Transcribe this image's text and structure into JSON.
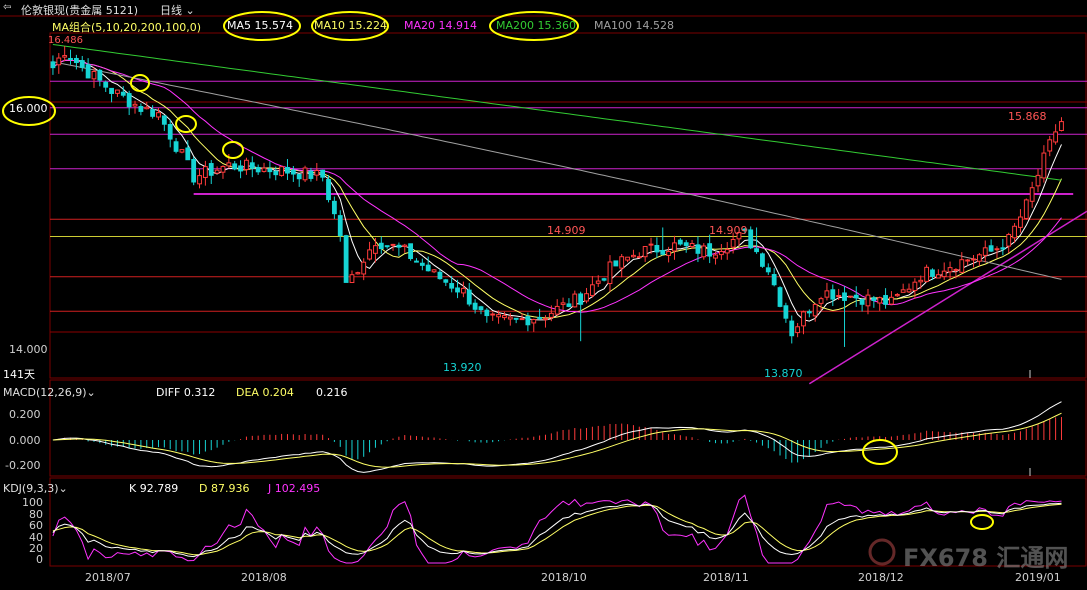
{
  "header": {
    "nav_icon": "back-arrow-icon",
    "instrument": "伦敦银现(贵金属 5121)",
    "period": "日线",
    "period_icon": "chevron-down-icon"
  },
  "colors": {
    "background": "#000000",
    "up": "#ff3b3b",
    "down": "#16d4d4",
    "ma5": "#ffffff",
    "ma10": "#ffff66",
    "ma20": "#ff33ff",
    "ma200": "#33cc33",
    "ma100": "#a0a0a0",
    "annotation_line": "#cc22cc",
    "annotation_circle": "#ffff00",
    "grid": "#8b0000"
  },
  "price_panel": {
    "indicator_label": "MA组合(5,10,20,200,100,0)",
    "ma_labels": {
      "ma5": "MA5 15.574",
      "ma10": "MA10 15.224",
      "ma20": "MA20 14.914",
      "ma200": "MA200 15.360",
      "ma100": "MA100 14.528"
    },
    "price_marks": {
      "left_high": "16.486",
      "recent_high": "15.868",
      "high_oct": "14.909",
      "high_nov": "14.909",
      "low_sep": "13.920",
      "low_nov": "13.870"
    },
    "y_ticks": [
      "16.000",
      "14.000"
    ],
    "days_label": "141天"
  },
  "macd_panel": {
    "label": "MACD(12,26,9)",
    "diff": "DIFF 0.312",
    "dea": "DEA 0.204",
    "macd": "0.216",
    "y_ticks": [
      "0.200",
      "0.000",
      "-0.200"
    ]
  },
  "kdj_panel": {
    "label": "KDJ(9,3,3)",
    "k": "K 92.789",
    "d": "D 87.936",
    "j": "J 102.495",
    "y_ticks": [
      "100",
      "80",
      "60",
      "40",
      "20",
      "0"
    ]
  },
  "x_axis": {
    "labels": [
      "2018/07",
      "2018/08",
      "2018/10",
      "2018/11",
      "2018/12",
      "2019/01"
    ]
  },
  "watermark": {
    "text": "FX678 汇通网",
    "icon": "fx678-logo-icon"
  },
  "chart_data": {
    "type": "candlestick",
    "y_range": [
      13.6,
      16.6
    ],
    "series": [
      {
        "name": "MA5",
        "values": [
          15.574
        ]
      },
      {
        "name": "MA10",
        "values": [
          15.224
        ]
      },
      {
        "name": "MA20",
        "values": [
          14.914
        ]
      },
      {
        "name": "MA200",
        "values": [
          15.36
        ]
      },
      {
        "name": "MA100",
        "values": [
          14.528
        ]
      }
    ],
    "anchors": [
      {
        "i": 0,
        "v": 16.3
      },
      {
        "i": 2,
        "v": 16.45
      },
      {
        "i": 5,
        "v": 16.3
      },
      {
        "i": 10,
        "v": 16.1
      },
      {
        "i": 15,
        "v": 15.95
      },
      {
        "i": 18,
        "v": 15.9
      },
      {
        "i": 24,
        "v": 15.35
      },
      {
        "i": 30,
        "v": 15.45
      },
      {
        "i": 40,
        "v": 15.4
      },
      {
        "i": 46,
        "v": 15.35
      },
      {
        "i": 49,
        "v": 14.85
      },
      {
        "i": 50,
        "v": 14.4
      },
      {
        "i": 55,
        "v": 14.8
      },
      {
        "i": 60,
        "v": 14.7
      },
      {
        "i": 65,
        "v": 14.5
      },
      {
        "i": 70,
        "v": 14.35
      },
      {
        "i": 74,
        "v": 14.1
      },
      {
        "i": 79,
        "v": 14.1
      },
      {
        "i": 84,
        "v": 14.15
      },
      {
        "i": 90,
        "v": 14.3
      },
      {
        "i": 95,
        "v": 14.55
      },
      {
        "i": 100,
        "v": 14.7
      },
      {
        "i": 106,
        "v": 14.75
      },
      {
        "i": 112,
        "v": 14.7
      },
      {
        "i": 118,
        "v": 14.85
      },
      {
        "i": 122,
        "v": 14.55
      },
      {
        "i": 126,
        "v": 14.0
      },
      {
        "i": 131,
        "v": 14.35
      },
      {
        "i": 138,
        "v": 14.3
      },
      {
        "i": 143,
        "v": 14.25
      },
      {
        "i": 148,
        "v": 14.5
      },
      {
        "i": 154,
        "v": 14.6
      },
      {
        "i": 160,
        "v": 14.7
      },
      {
        "i": 163,
        "v": 14.8
      },
      {
        "i": 166,
        "v": 15.1
      },
      {
        "i": 169,
        "v": 15.5
      },
      {
        "i": 171,
        "v": 15.75
      },
      {
        "i": 172,
        "v": 15.83
      }
    ],
    "highlight_candles": [
      {
        "i": 2,
        "high": 16.486
      },
      {
        "i": 90,
        "low": 13.92
      },
      {
        "i": 104,
        "high": 14.909
      },
      {
        "i": 120,
        "high": 14.909
      },
      {
        "i": 135,
        "low": 13.87
      },
      {
        "i": 172,
        "high": 15.868
      }
    ],
    "horizontal_lines": [
      {
        "price": 16.18,
        "from": 0,
        "to": 174
      },
      {
        "price": 15.95,
        "from": 0,
        "to": 174
      },
      {
        "price": 15.72,
        "from": 0,
        "to": 174
      },
      {
        "price": 15.42,
        "from": 0,
        "to": 174
      },
      {
        "price": 15.2,
        "from": 24,
        "to": 174
      },
      {
        "price": 14.98,
        "from": 0,
        "to": 174
      },
      {
        "price": 14.83,
        "from": 100,
        "to": 160
      },
      {
        "price": 14.48,
        "from": 148,
        "to": 160
      },
      {
        "price": 14.18,
        "from": 138,
        "to": 155
      }
    ],
    "trend_line": {
      "from_i": 129,
      "from_v": 13.55,
      "to_i": 180,
      "to_v": 15.05
    }
  }
}
